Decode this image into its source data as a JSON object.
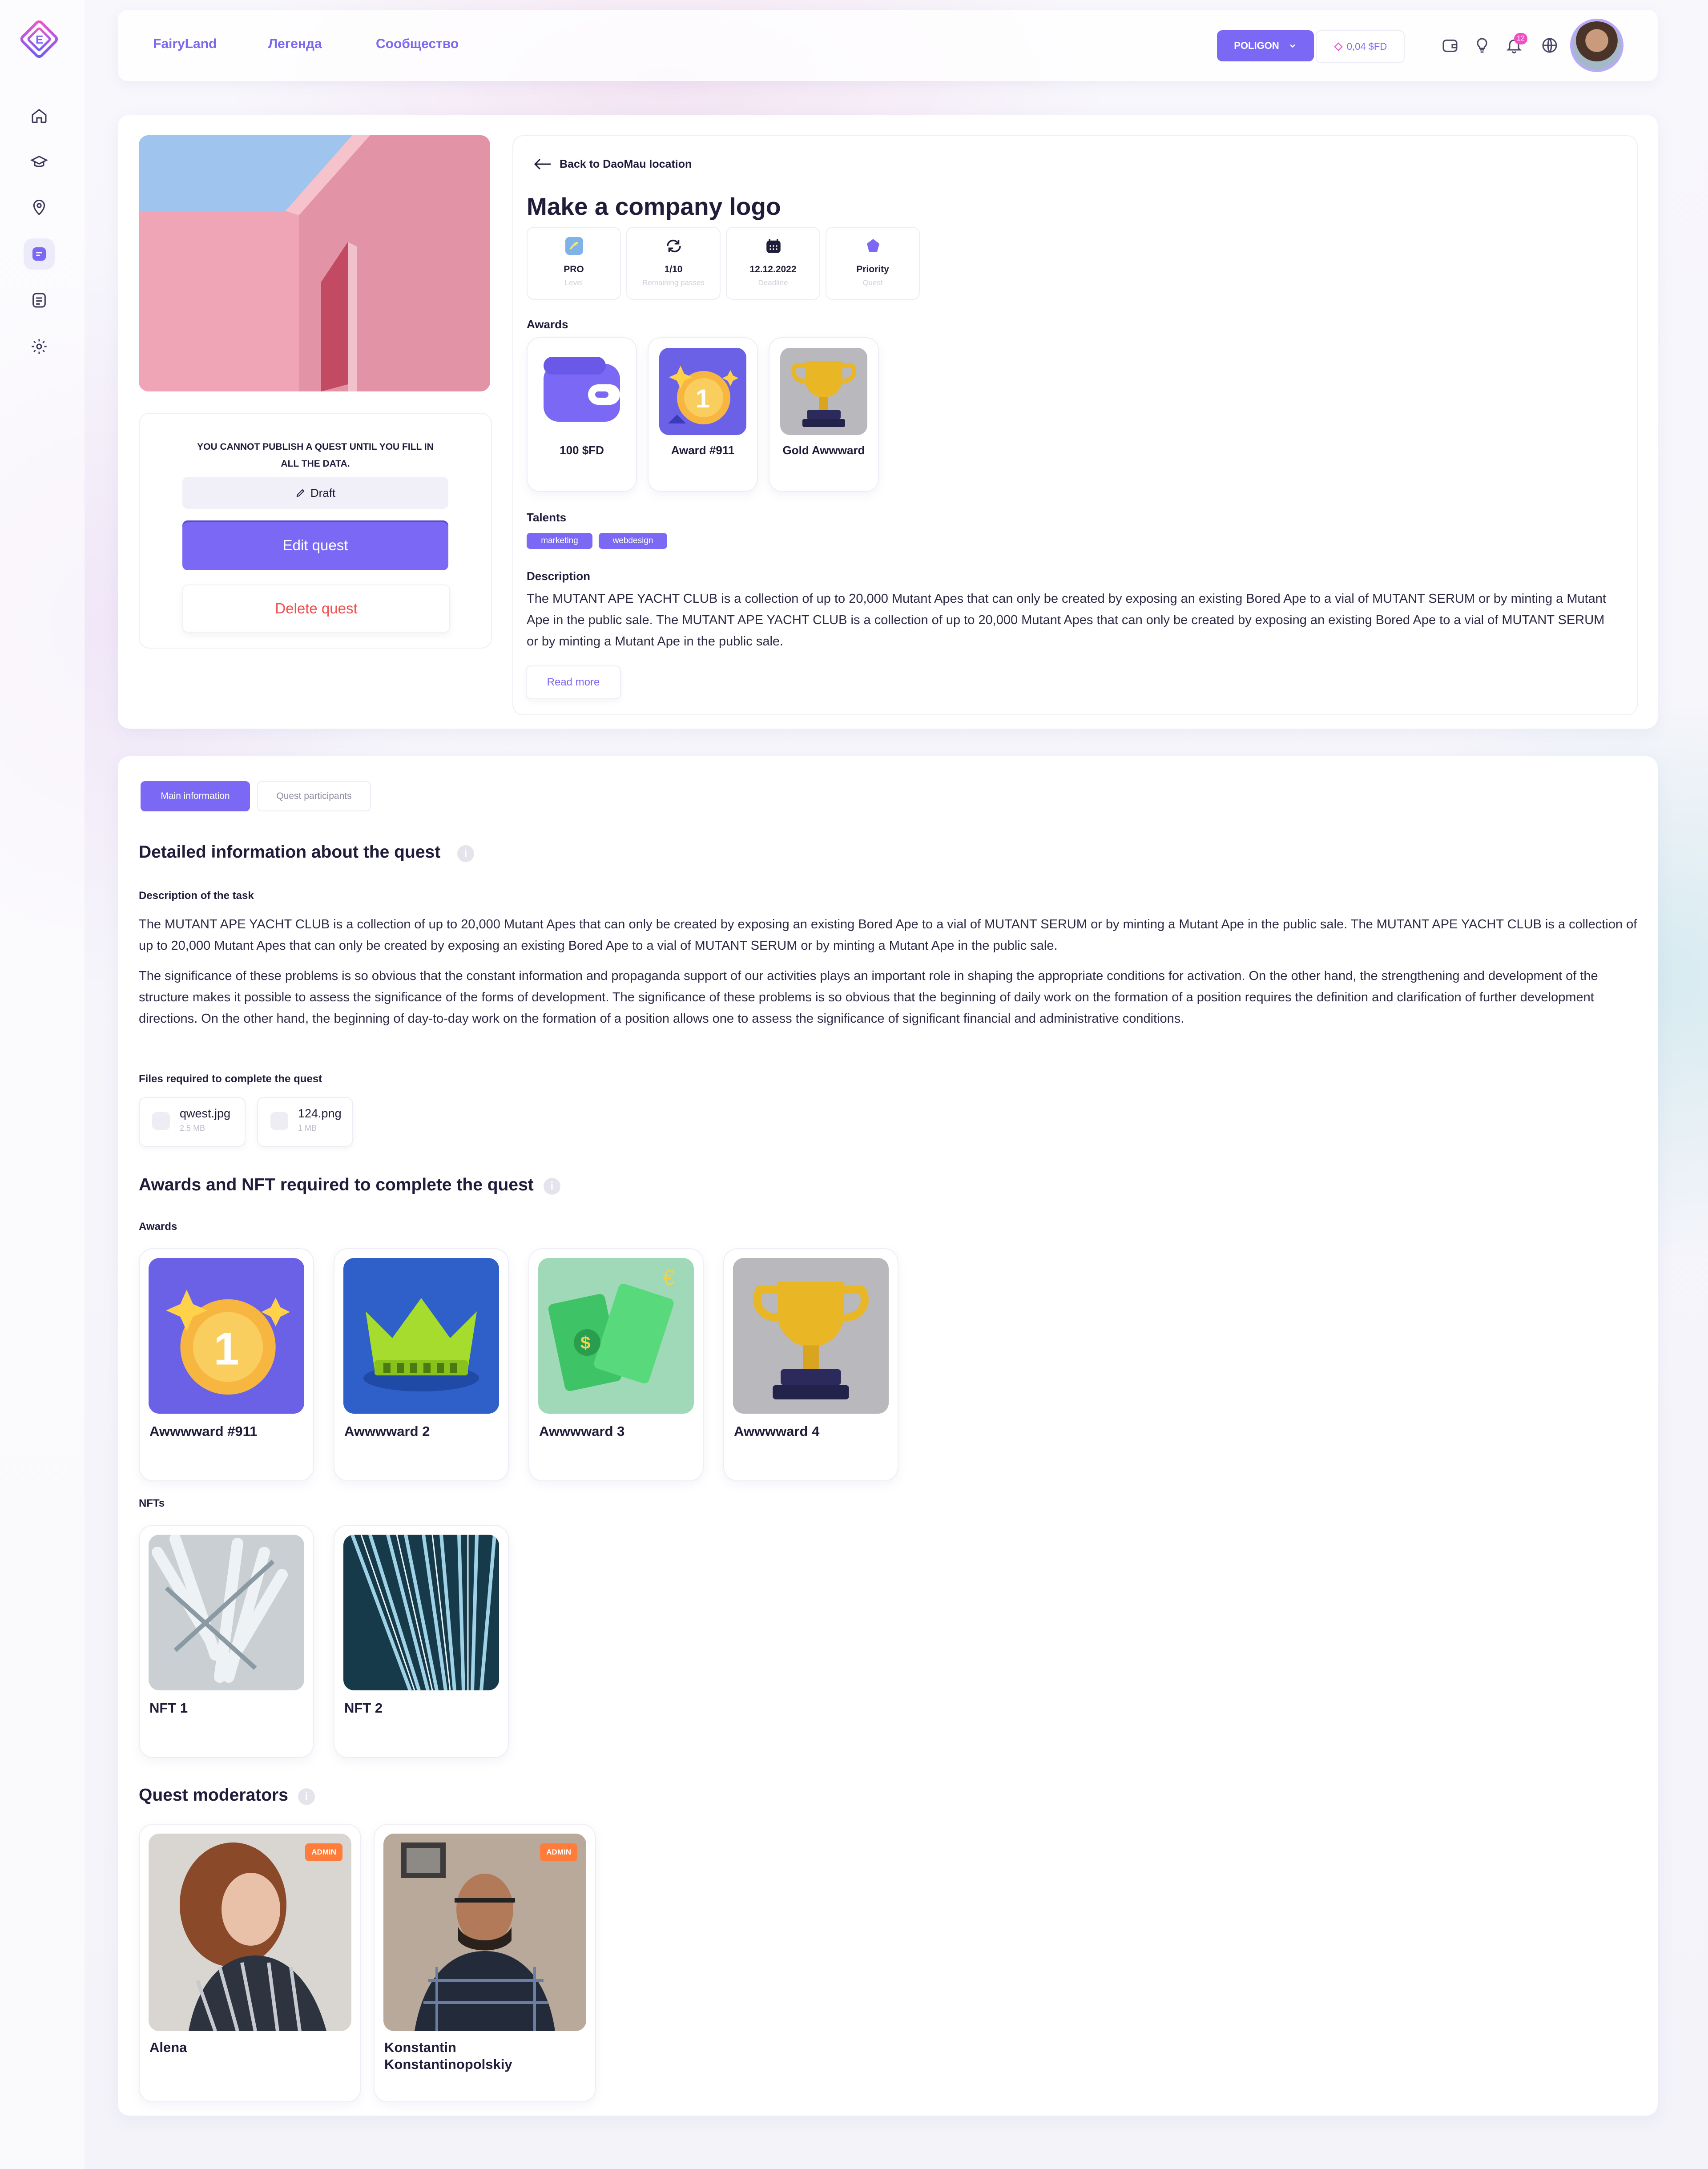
{
  "header": {
    "nav": [
      "FairyLand",
      "Легенда",
      "Сообщество"
    ],
    "network": "POLIGON",
    "balance": "0,04 $FD",
    "notifications": "12"
  },
  "quest_card": {
    "warning": "YOU CANNOT PUBLISH A QUEST UNTIL YOU FILL IN ALL THE DATA.",
    "status": "Draft",
    "edit_label": "Edit quest",
    "delete_label": "Delete quest"
  },
  "quest": {
    "back_label": "Back to DaoMau location",
    "title": "Make a company logo",
    "stats": [
      {
        "value": "PRO",
        "label": "Level",
        "icon": "level-icon"
      },
      {
        "value": "1/10",
        "label": "Remaining passes",
        "icon": "repeat-icon"
      },
      {
        "value": "12.12.2022",
        "label": "Deadline",
        "icon": "calendar-icon"
      },
      {
        "value": "Priority",
        "label": "Quest",
        "icon": "crown-icon"
      }
    ],
    "awards_label": "Awards",
    "awards": [
      "100 $FD",
      "Award #911",
      "Gold Awwward"
    ],
    "talents_label": "Talents",
    "talents": [
      "marketing",
      "webdesign"
    ],
    "description_label": "Description",
    "description": "The MUTANT APE YACHT CLUB is a collection of up to 20,000 Mutant Apes that can only be created by exposing an existing Bored Ape to a vial of MUTANT SERUM or by minting a Mutant Ape in the public sale. The MUTANT APE YACHT CLUB is a collection of up to 20,000 Mutant Apes that can only be created by exposing an existing Bored Ape to a vial of MUTANT SERUM or by minting a Mutant Ape in the public sale.",
    "read_more": "Read more"
  },
  "tabs": [
    "Main information",
    "Quest participants"
  ],
  "details": {
    "title": "Detailed information about the quest",
    "task_label": "Description of the task",
    "task_p1": "The MUTANT APE YACHT CLUB is a collection of up to 20,000 Mutant Apes that can only be created by exposing an existing Bored Ape to a vial of MUTANT SERUM or by minting a Mutant Ape in the public sale. The MUTANT APE YACHT CLUB is a collection of up to 20,000 Mutant Apes that can only be created by exposing an existing Bored Ape to a vial of MUTANT SERUM or by minting a Mutant Ape in the public sale.",
    "task_p2": "The significance of these problems is so obvious that the constant information and propaganda support of our activities plays an important role in shaping the appropriate conditions for activation. On the other hand, the strengthening and development of the structure makes it possible to assess the significance of the forms of development. The significance of these problems is so obvious that the beginning of daily work on the formation of a position requires the definition and clarification of further development directions. On the other hand, the beginning of day-to-day work on the formation of a position allows one to assess the significance of significant financial and administrative conditions.",
    "files_label": "Files required to complete the quest",
    "files": [
      {
        "name": "qwest.jpg",
        "size": "2.5 MB"
      },
      {
        "name": "124.png",
        "size": "1 MB"
      }
    ]
  },
  "awards_nft": {
    "title": "Awards and NFT required to complete the quest",
    "awards_label": "Awards",
    "awards": [
      "Awwwward #911",
      "Awwwward 2",
      "Awwwward 3",
      "Awwwward 4"
    ],
    "nfts_label": "NFTs",
    "nfts": [
      "NFT 1",
      "NFT 2"
    ]
  },
  "moderators": {
    "title": "Quest moderators",
    "items": [
      {
        "name": "Alena",
        "role": "ADMIN"
      },
      {
        "name": "Konstantin Konstantinopolskiy",
        "role": "ADMIN"
      }
    ]
  },
  "colors": {
    "accent": "#7b69f5",
    "danger": "#ef4f4f",
    "admin": "#ff7c3b"
  }
}
